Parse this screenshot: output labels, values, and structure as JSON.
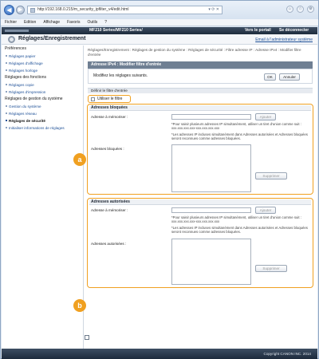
{
  "browser": {
    "url": "http://192.168.0.215/m_security_ipfilter_v4/edit.html",
    "url_controls": "▾ ⟳ ✕",
    "menu": [
      "Fichier",
      "Edition",
      "Affichage",
      "Favoris",
      "Outils",
      "?"
    ]
  },
  "topbar": {
    "model": "MF210 Series/MF210 Series/",
    "portal": "Vers le portail",
    "logout": "Se déconnecter"
  },
  "header": {
    "title": "Réglages/Enregistrement",
    "mail_link": "Email à l'administrateur système"
  },
  "sidebar": {
    "sec1": "Préférences",
    "i1": "Réglages papier",
    "i2": "Réglages d'affichage",
    "i3": "Réglages horloge",
    "sec2": "Réglages des fonctions",
    "i4": "Réglages copie",
    "i5": "Réglages d'impression",
    "sec3": "Réglages de gestion du système",
    "i6": "Gestion du système",
    "i7": "Réglages réseau",
    "i8": "Réglages de sécurité",
    "i9": "Initialiser informations de réglages"
  },
  "breadcrumb": "Réglages/Enregistrement : Réglages de gestion du système : Réglages de sécurité : Filtre adresse IP : Adresse IPv4 : Modifier filtre d'entrée",
  "panel": {
    "title": "Adresse IPv4 : Modifier filtre d'entrée",
    "message": "Modifiez les réglages suivants.",
    "ok": "OK",
    "cancel": "Annuler"
  },
  "section_title": "Définir le filtre d'entrée",
  "use_filter_label": "Utiliser le filtre",
  "blocked": {
    "title": "Adresses bloquées",
    "address_label": "Adresse à mémoriser :",
    "add_button": "Ajouter",
    "hint1": "*Pour saisir plusieurs adresses IP simultanément, utiliser un tiret d'union comme suit : xxx.xxx.xxx.xxx-xxx.xxx.xxx.xxx",
    "hint2": "*Les adresses IP incluses simultanément dans Adresses autorisées et Adresses bloquées seront reconnues comme adresses bloquées.",
    "list_label": "Adresses bloquées :",
    "delete_button": "Supprimer",
    "badge": "a"
  },
  "allowed": {
    "title": "Adresses autorisées",
    "address_label": "Adresse à mémoriser :",
    "add_button": "Ajouter",
    "hint1": "*Pour saisir plusieurs adresses IP simultanément, utiliser un tiret d'union comme suit : xxx.xxx.xxx.xxx-xxx.xxx.xxx.xxx",
    "hint2": "*Les adresses IP incluses simultanément dans Adresses autorisées et Adresses bloquées seront reconnues comme adresses bloquées.",
    "list_label": "Adresses autorisées :",
    "delete_button": "Supprimer",
    "badge": "b"
  },
  "footer": "Copyright CANON INC. 2014"
}
